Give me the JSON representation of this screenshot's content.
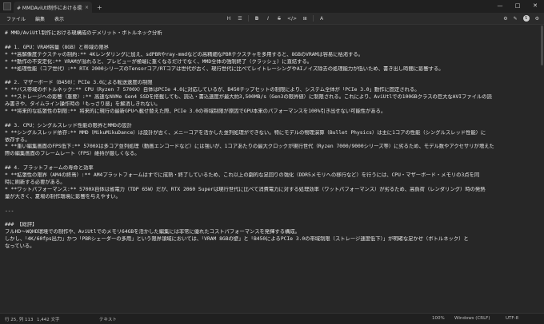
{
  "window": {
    "tab_title": "# MMDAviUtl制作における環境構成",
    "tab_close": "×",
    "new_tab": "+",
    "controls": [
      "—",
      "□",
      "✕"
    ]
  },
  "menu": [
    "ファイル",
    "編集",
    "表示"
  ],
  "toolbar": [
    "H",
    "☰",
    "B",
    "I",
    "S",
    "</>",
    "⊞",
    "A"
  ],
  "right_tools": [
    "⚙",
    "✎",
    "S",
    "⚙"
  ],
  "editor": {
    "lines": [
      "# MMD/AviUtl制作における現構成のデメリット・ボトルネック分析",
      "",
      "## 1. GPU：VRAM容量（8GB）と帯域の限界",
      "* **高解像度テクスチャの制約:** 4Kレンダリングに加え、sdPBRやray-mmdなどの高精細なPBRテクスチャを多用すると、8GBのVRAMは容易に枯渇する。",
      "* **動作の不安定化:** VRAMが溢れると、プレビューが極端に重くなるだけでなく、MMD全体の強制終了（クラッシュ）に直結する。",
      "* **処理性能（コア世代）:** RTX 2000シリーズのTensorコア/RTコアは世代が古く、現行世代に比べてレイトレーシングやAIノイズ除去の処理能力が低いため、書き出し時間に影響する。",
      "",
      "## 2. マザーボード（B450）：PCIe 3.0による転送速度の制限",
      "* **バス帯域のボトルネック:** CPU（Ryzen 7 5700X）自体はPCIe 4.0に対応しているが、B450チップセットの制限により、システム全体が「PCIe 3.0」動作に固定される。",
      "* **ストレージへの影響（重要）:** 高速なNVMe Gen4 SSDを搭載しても、読込・書込速度が最大約3,500MB/s（Gen3の限界値）に制限される。これにより、AviUtlでの100GBクラスの巨大なAVIファイルの読",
      "み書きや、タイムライン操作時の「もっさり感」を解消しきれない。",
      "* **将来的な拡張性の制限:** 将来的に現行の最新GPUへ載せ替えた際、PCIe 3.0の帯域制限が原因でGPU本来のパフォーマンスを100%引き出せない可能性がある。",
      "",
      "## 3. CPU：シングルスレッド性能の限界とMMDの設計",
      "* **シングルスレッド依存:** MMD（MikuMikuDance）は設計が古く、メニーコアを活かした並列処理ができない。特にモデルの物理演算（Bullet Physics）は主に1コアの性能（シングルスレッド性能）に",
      "依存する。",
      "* **重い編集画面のFPS低下:** 5700Xは多コア並列処理（動画エンコードなど）には強いが、1コアあたりの最大クロックが現行世代（Ryzen 7000/9000シリーズ等）に劣るため、モデル数やアクセサリが増えた",
      "際の編集画面のフレームレート（FPS）維持が厳しくなる。",
      "",
      "## 4. プラットフォームの寿命と効率",
      "* **拡張性の限界（AM4の終焉）:** AM4プラットフォームはすでに成熟・終了しているため、これ以上の劇的な足回りの強化（DDR5メモリへの移行など）を行うには、CPU・マザーボード・メモリの3点を同",
      "時に刷新する必要がある。",
      "* **ワットパフォーマンス:** 5700X自体は省電力（TDP 65W）だが、RTX 2060 Superは現行世代に比べて消費電力に対する処理効率（ワットパフォーマンス）が劣るため、高負荷（レンダリング）時の発熱",
      "量が大きく、夏場の制作環境に影響を与えやすい。",
      "",
      "---",
      "",
      "### 【総評】",
      "フルHD～WQHD環境での制作や、AviUtlでのメモリ64GBを活かした編集には非常に優れたコストパフォーマンスを発揮する構成。",
      "しかし、「4K/60fps出力」かつ「PBRシェーダーの多用」という限界領域においては、「VRAM 8GBの壁」と「B450によるPCIe 3.0の帯域制限（ストレージ速度低下）」が明確な足かせ（ボトルネック）と",
      "なっている。"
    ]
  },
  "status": {
    "position": "行 25, 列 113",
    "chars": "1,442 文字",
    "format": "テキスト",
    "zoom": "100%",
    "line_ending": "Windows (CRLF)",
    "encoding": "UTF-8"
  }
}
